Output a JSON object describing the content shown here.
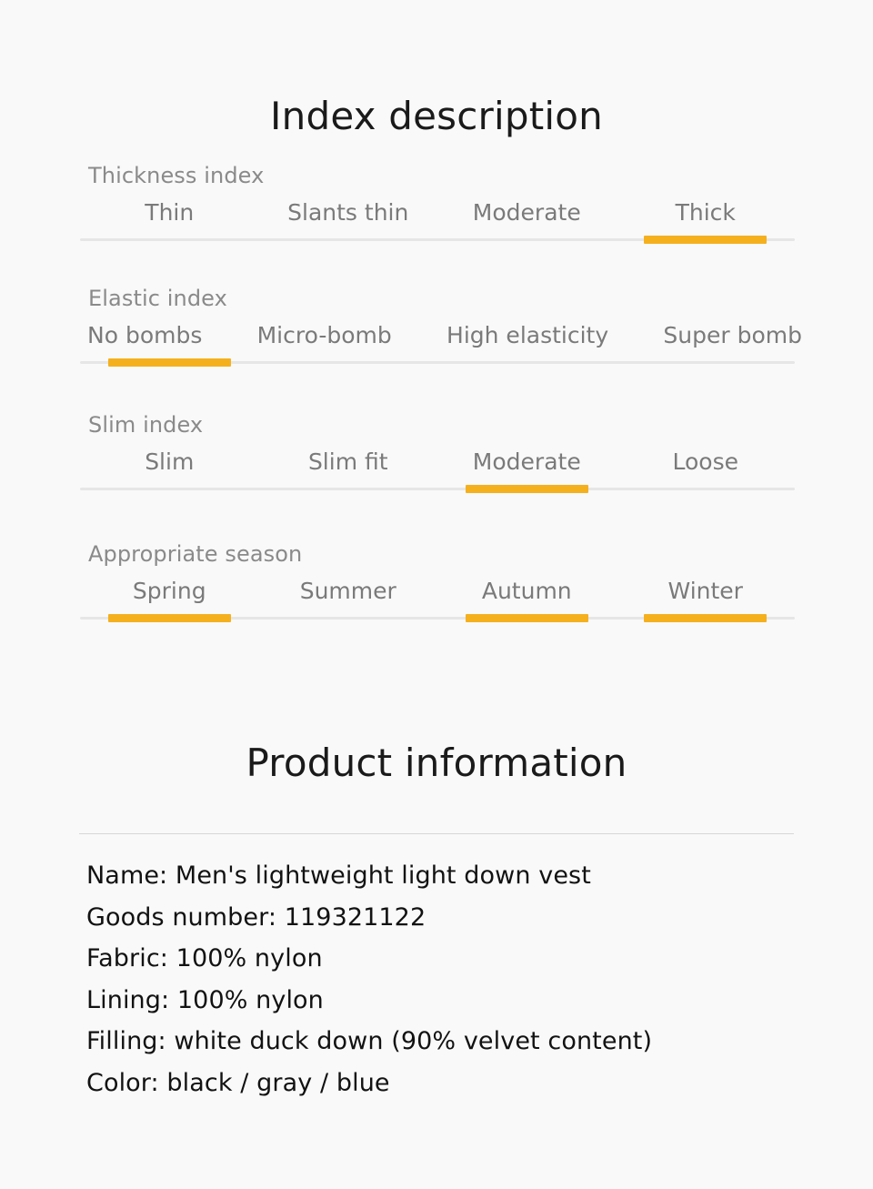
{
  "theme": {
    "background": "#f9f9f9",
    "accent": "#f5b01e",
    "track": "#e6e6e6",
    "label_gray": "#8a8a8a",
    "option_gray": "#7a7a7a",
    "text_dark": "#121212",
    "divider": "#d6d6d6"
  },
  "index_section": {
    "title": "Index description",
    "groups": [
      {
        "label": "Thickness index",
        "layout": "even",
        "options": [
          "Thin",
          "Slants thin",
          "Moderate",
          "Thick"
        ],
        "selected": [
          3
        ]
      },
      {
        "label": "Elastic index",
        "layout": "tight",
        "options": [
          "No bombs",
          "Micro-bomb",
          "High elasticity",
          "Super bomb"
        ],
        "selected": [
          0
        ]
      },
      {
        "label": "Slim index",
        "layout": "even",
        "options": [
          "Slim",
          "Slim fit",
          "Moderate",
          "Loose"
        ],
        "selected": [
          2
        ]
      },
      {
        "label": "Appropriate season",
        "layout": "even",
        "options": [
          "Spring",
          "Summer",
          "Autumn",
          "Winter"
        ],
        "selected": [
          0,
          2,
          3
        ]
      }
    ]
  },
  "product_section": {
    "title": "Product information",
    "lines": [
      "Name: Men's lightweight light down vest",
      "Goods number: 119321122",
      "Fabric: 100% nylon",
      "Lining: 100% nylon",
      "Filling: white duck down (90% velvet content)",
      "Color: black / gray / blue"
    ]
  }
}
